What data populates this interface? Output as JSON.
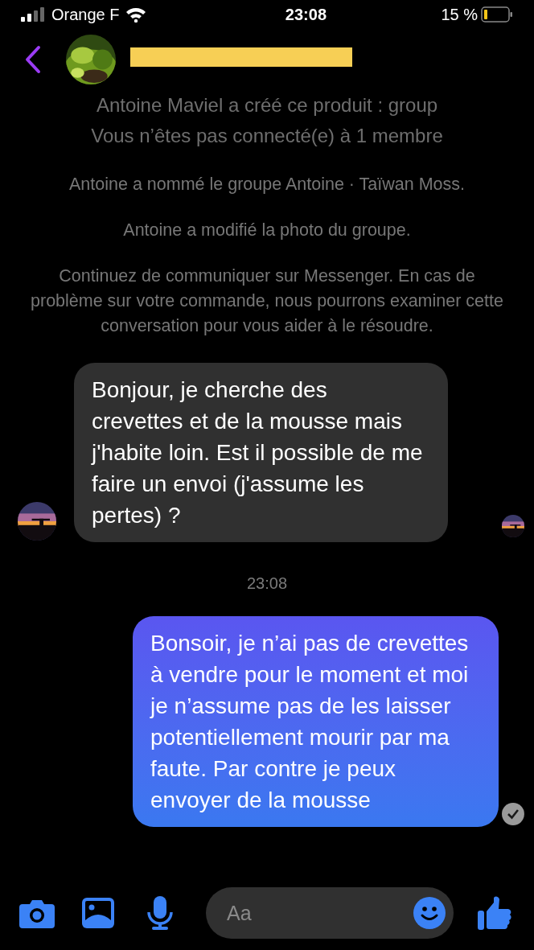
{
  "status_bar": {
    "carrier": "Orange F",
    "time": "23:08",
    "battery": "15 %"
  },
  "header": {
    "redacted": true
  },
  "notices": [
    {
      "text": "Antoine Maviel a créé ce produit : group",
      "kind": "info"
    },
    {
      "text": "Vous n’êtes pas connecté(e) à 1 membre",
      "kind": "info"
    },
    {
      "text": "Antoine a nommé le groupe Antoine · Taïwan Moss.",
      "kind": "event"
    },
    {
      "text": "Antoine a modifié la photo du groupe.",
      "kind": "event"
    },
    {
      "text": "Continuez de communiquer sur Messenger. En cas de problème sur votre commande, nous pourrons examiner cette conversation pour vous aider à le résoudre.",
      "kind": "event"
    }
  ],
  "messages": [
    {
      "kind": "incoming",
      "text": "Bonjour, je cherche des crevettes et de la mousse mais j'habite loin. Est il possible de me faire un envoi (j'assume les pertes) ?",
      "seen": true
    },
    {
      "kind": "timestamp",
      "text": "23:08"
    },
    {
      "kind": "outgoing",
      "text": "Bonsoir, je n’ai pas de crevettes à vendre pour le moment et moi je n’assume pas de les laisser potentiellement mourir par ma faute. Par contre je peux envoyer de la mousse",
      "delivered": true
    }
  ],
  "composer": {
    "placeholder": "Aa"
  }
}
